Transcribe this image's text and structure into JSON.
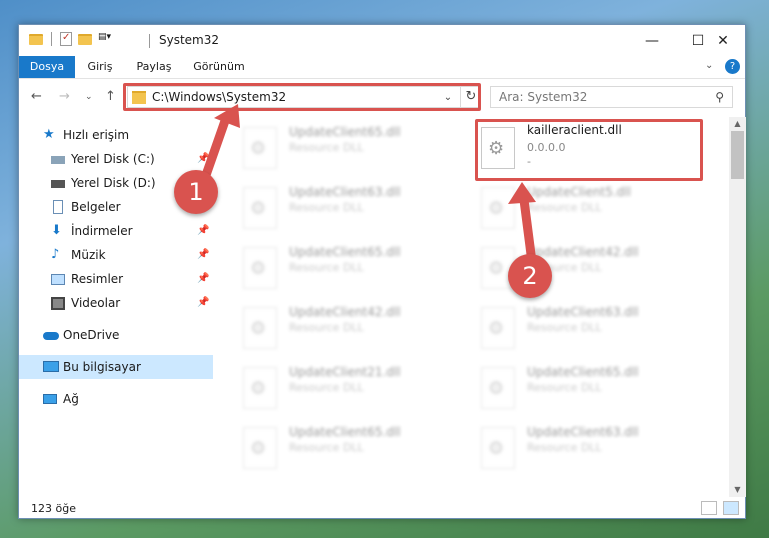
{
  "window": {
    "title": "System32",
    "controls": {
      "minimize": "—",
      "maximize": "☐",
      "close": "✕"
    }
  },
  "ribbon": {
    "tabs": [
      {
        "label": "Dosya"
      },
      {
        "label": "Giriş"
      },
      {
        "label": "Paylaş"
      },
      {
        "label": "Görünüm"
      }
    ],
    "help": "?"
  },
  "address": {
    "path": "C:\\Windows\\System32",
    "search_placeholder": "Ara: System32"
  },
  "sidebar": {
    "items": [
      {
        "label": "Hızlı erişim",
        "icon": "star-icon",
        "pinned": false
      },
      {
        "label": "Yerel Disk (C:)",
        "icon": "drive-icon",
        "pinned": true
      },
      {
        "label": "Yerel Disk (D:)",
        "icon": "drive-icon",
        "pinned": true
      },
      {
        "label": "Belgeler",
        "icon": "documents-icon",
        "pinned": true
      },
      {
        "label": "İndirmeler",
        "icon": "download-icon",
        "pinned": true
      },
      {
        "label": "Müzik",
        "icon": "music-icon",
        "pinned": true
      },
      {
        "label": "Resimler",
        "icon": "pictures-icon",
        "pinned": true
      },
      {
        "label": "Videolar",
        "icon": "video-icon",
        "pinned": true
      },
      {
        "label": "OneDrive",
        "icon": "cloud-icon",
        "pinned": false
      },
      {
        "label": "Bu bilgisayar",
        "icon": "computer-icon",
        "pinned": false,
        "selected": true
      },
      {
        "label": "Ağ",
        "icon": "network-icon",
        "pinned": false
      }
    ]
  },
  "files": {
    "highlighted": {
      "name": "kailleraclient.dll",
      "version": "0.0.0.0",
      "extra": "-"
    },
    "left_column": [
      {
        "name": "UpdateClient65.dll",
        "type": "Resource DLL"
      },
      {
        "name": "UpdateClient63.dll",
        "type": "Resource DLL"
      },
      {
        "name": "UpdateClient65.dll",
        "type": "Resource DLL"
      },
      {
        "name": "UpdateClient42.dll",
        "type": "Resource DLL"
      },
      {
        "name": "UpdateClient21.dll",
        "type": "Resource DLL"
      },
      {
        "name": "UpdateClient65.dll",
        "type": "Resource DLL"
      }
    ],
    "right_column": [
      {
        "name": "UpdateClient5.dll",
        "type": "Resource DLL"
      },
      {
        "name": "UpdateClient42.dll",
        "type": "Resource DLL"
      },
      {
        "name": "UpdateClient63.dll",
        "type": "Resource DLL"
      },
      {
        "name": "UpdateClient65.dll",
        "type": "Resource DLL"
      },
      {
        "name": "UpdateClient63.dll",
        "type": "Resource DLL"
      }
    ]
  },
  "status": {
    "count": "123 öğe"
  },
  "callouts": {
    "step1": "1",
    "step2": "2"
  },
  "colors": {
    "accent": "#1979ca",
    "highlight": "#d9534f",
    "selected": "#cce8ff"
  }
}
